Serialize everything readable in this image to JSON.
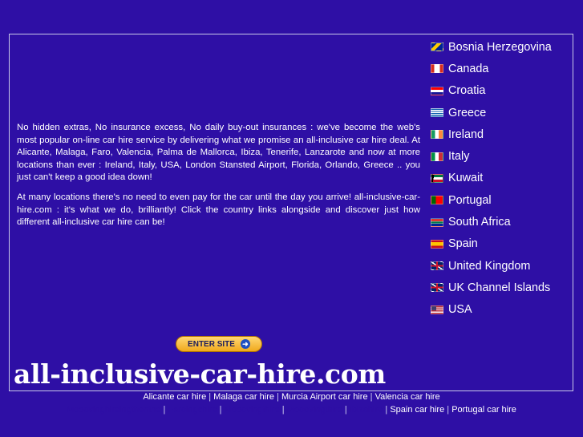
{
  "intro": {
    "paragraph1": "No hidden extras, No insurance excess, No daily buy-out insurances : we've become the web's most popular on-line car hire service by delivering what we promise an all-inclusive car hire deal. At Alicante, Malaga, Faro, Valencia, Palma de Mallorca, Ibiza, Tenerife, Lanzarote and now at more locations than ever : Ireland, Italy, USA, London Stansted Airport, Florida, Orlando, Greece .. you just can't keep a good idea down!",
    "paragraph2": "At many locations there's no need to even pay for the car until the day you arrive! all-inclusive-car-hire.com : it's what we do, brilliantly! Click the country links alongside and discover just how different all-inclusive car hire can be!"
  },
  "countries": [
    {
      "label": "Bosnia Herzegovina",
      "icon": "bosnia-flag-icon"
    },
    {
      "label": "Canada",
      "icon": "canada-flag-icon"
    },
    {
      "label": "Croatia",
      "icon": "croatia-flag-icon"
    },
    {
      "label": "Greece",
      "icon": "greece-flag-icon"
    },
    {
      "label": "Ireland",
      "icon": "ireland-flag-icon"
    },
    {
      "label": "Italy",
      "icon": "italy-flag-icon"
    },
    {
      "label": "Kuwait",
      "icon": "kuwait-flag-icon"
    },
    {
      "label": "Portugal",
      "icon": "portugal-flag-icon"
    },
    {
      "label": "South Africa",
      "icon": "south-africa-flag-icon"
    },
    {
      "label": "Spain",
      "icon": "spain-flag-icon"
    },
    {
      "label": "United Kingdom",
      "icon": "uk-flag-icon"
    },
    {
      "label": "UK Channel Islands",
      "icon": "uk-flag-icon"
    },
    {
      "label": "USA",
      "icon": "usa-flag-icon"
    }
  ],
  "enter_button": {
    "label": "ENTER SITE",
    "icon": "arrow-right-icon"
  },
  "logo": {
    "text": "all-inclusive-car-hire.com"
  },
  "footer": {
    "row1": [
      "Alicante car hire",
      "Malaga car hire",
      "Murcia Airport car hire",
      "Valencia car hire"
    ],
    "row2_visible": [
      "Spain car hire",
      "Portugal car hire"
    ],
    "separator": " | "
  },
  "colors": {
    "background": "#2e0fa5",
    "text": "#ffffff",
    "button": "#f0a91c"
  }
}
